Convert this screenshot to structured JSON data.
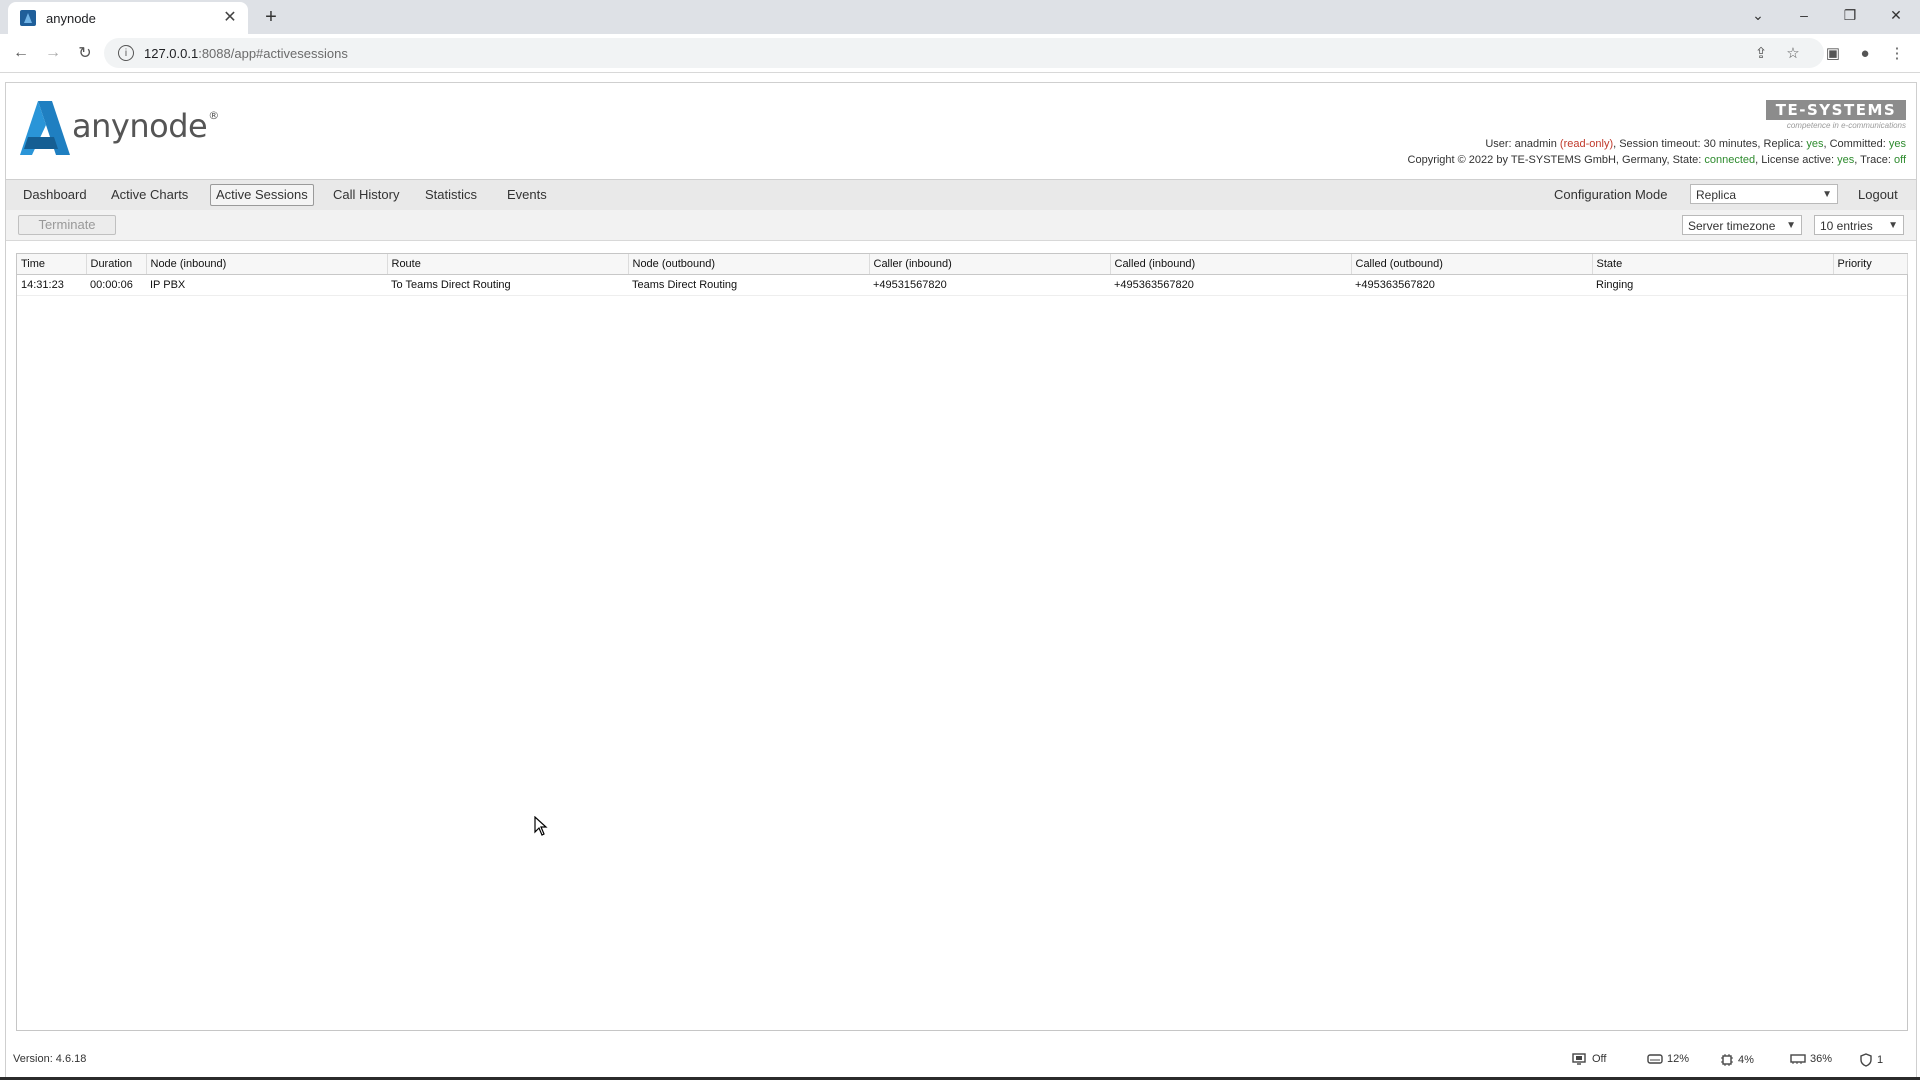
{
  "browser": {
    "tab_title": "anynode",
    "url_host": "127.0.0.1",
    "url_path": ":8088/app#activesessions"
  },
  "header": {
    "logo_text": "anynode",
    "logo_mark": "®",
    "brand": "TE-SYSTEMS",
    "brand_tagline": "competence in e-communications",
    "user_label": "User:",
    "user_name": "anadmin",
    "user_mode": "(read-only)",
    "session_timeout": ", Session timeout: 30 minutes, Replica:",
    "replica": "yes",
    "committed_label": ", Committed:",
    "committed": "yes",
    "copyright": "Copyright © 2022 by TE-SYSTEMS GmbH, Germany, State:",
    "state": "connected",
    "license_label": ", License active:",
    "license": "yes",
    "trace_label": ", Trace:",
    "trace": "off"
  },
  "nav": {
    "items": [
      "Dashboard",
      "Active Charts",
      "Active Sessions",
      "Call History",
      "Statistics",
      "Events"
    ],
    "active": "Active Sessions",
    "config_mode_label": "Configuration Mode",
    "config_mode_value": "Replica",
    "logout": "Logout"
  },
  "actions": {
    "terminate": "Terminate",
    "timezone": "Server timezone",
    "entries": "10 entries"
  },
  "table": {
    "columns": [
      "Time",
      "Duration",
      "Node (inbound)",
      "Route",
      "Node (outbound)",
      "Caller (inbound)",
      "Called (inbound)",
      "Called (outbound)",
      "State",
      "Priority"
    ],
    "rows": [
      [
        "14:31:23",
        "00:00:06",
        "IP PBX",
        "To Teams Direct Routing",
        "Teams Direct Routing",
        "+49531567820",
        "+495363567820",
        "+495363567820",
        "Ringing",
        ""
      ]
    ]
  },
  "status": {
    "version": "Version: 4.6.18",
    "indicators": [
      {
        "icon": "monitor-icon",
        "value": "Off"
      },
      {
        "icon": "disk-icon",
        "value": "12%"
      },
      {
        "icon": "cpu-icon",
        "value": "4%"
      },
      {
        "icon": "memory-icon",
        "value": "36%"
      },
      {
        "icon": "shield-icon",
        "value": "1"
      }
    ]
  },
  "colors": {
    "accent": "#1f7fc1",
    "red": "#c0392b",
    "green": "#2e8b2e"
  }
}
